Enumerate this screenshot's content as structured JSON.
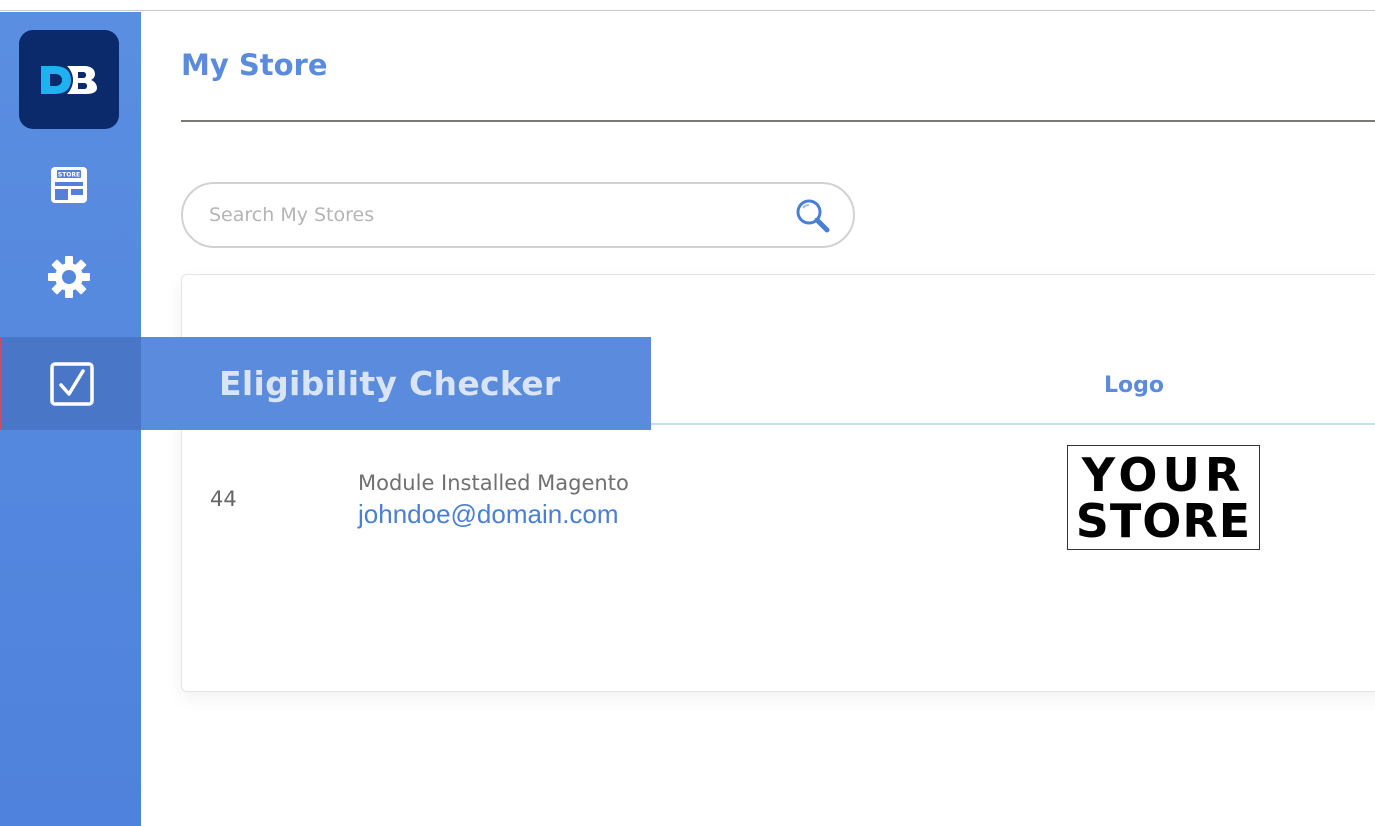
{
  "app": {
    "logo_text": "DB"
  },
  "sidebar": {
    "items": [
      {
        "name": "store",
        "icon": "store-icon",
        "badge": "STORE"
      },
      {
        "name": "settings",
        "icon": "gear-icon"
      },
      {
        "name": "eligibility-checker",
        "icon": "checkbox-icon",
        "label": "Eligibility Checker",
        "active": true
      }
    ]
  },
  "page": {
    "title": "My Store"
  },
  "search": {
    "placeholder": "Search My Stores",
    "value": ""
  },
  "table": {
    "columns": {
      "logo": "Logo"
    },
    "rows": [
      {
        "id": "44",
        "name": "Module Installed Magento",
        "email": "johndoe@domain.com",
        "logo": {
          "line1": "YOUR",
          "line2": "STORE"
        }
      }
    ]
  },
  "colors": {
    "accent": "#5b8bdc",
    "sidebar": "#5080dc",
    "app_logo_bg": "#0b2a6b",
    "link": "#4a7fd6"
  }
}
